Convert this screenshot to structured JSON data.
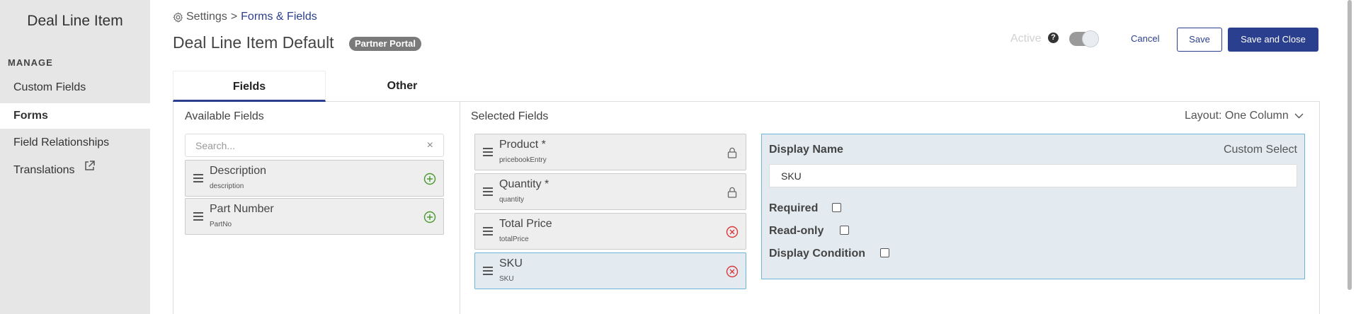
{
  "sidebar": {
    "title": "Deal Line Item",
    "section_heading": "MANAGE",
    "items": [
      {
        "label": "Custom Fields",
        "active": false
      },
      {
        "label": "Forms",
        "active": true
      },
      {
        "label": "Field Relationships",
        "active": false
      },
      {
        "label": "Translations",
        "active": false,
        "icon": "external-link-icon"
      }
    ]
  },
  "header": {
    "breadcrumb": {
      "icon": "gear-icon",
      "root": "Settings",
      "separator": ">",
      "current": "Forms & Fields"
    },
    "title": "Deal Line Item Default",
    "badge": "Partner Portal",
    "active_label": "Active",
    "help_icon": "?",
    "active_toggle_on": true,
    "cancel_label": "Cancel",
    "save_label": "Save",
    "save_close_label": "Save and Close"
  },
  "tabs": [
    {
      "label": "Fields",
      "active": true
    },
    {
      "label": "Other",
      "active": false
    }
  ],
  "available_fields": {
    "heading": "Available Fields",
    "search_placeholder": "Search...",
    "clear_icon": "×",
    "items": [
      {
        "name": "Description",
        "key": "description",
        "action_icon": "add-circle-icon"
      },
      {
        "name": "Part Number",
        "key": "PartNo",
        "action_icon": "add-circle-icon"
      }
    ]
  },
  "selected_fields": {
    "heading": "Selected Fields",
    "layout_label": "Layout: One Column",
    "items": [
      {
        "name": "Product *",
        "key": "pricebookEntry",
        "action_icon": "lock-icon",
        "selected": false
      },
      {
        "name": "Quantity *",
        "key": "quantity",
        "action_icon": "lock-icon",
        "selected": false
      },
      {
        "name": "Total Price",
        "key": "totalPrice",
        "action_icon": "remove-circle-icon",
        "selected": false
      },
      {
        "name": "SKU",
        "key": "SKU",
        "action_icon": "remove-circle-icon",
        "selected": true
      }
    ]
  },
  "field_detail": {
    "display_name_label": "Display Name",
    "type_label": "Custom Select",
    "display_name_value": "SKU",
    "required_label": "Required",
    "required_checked": false,
    "readonly_label": "Read-only",
    "readonly_checked": false,
    "display_condition_label": "Display Condition",
    "display_condition_checked": false
  },
  "colors": {
    "brand": "#2b3f8f",
    "add_green": "#4a9a2f",
    "remove_red": "#d9383a",
    "selected_bg": "#e3ebf1",
    "selected_border": "#6fb4d9"
  }
}
